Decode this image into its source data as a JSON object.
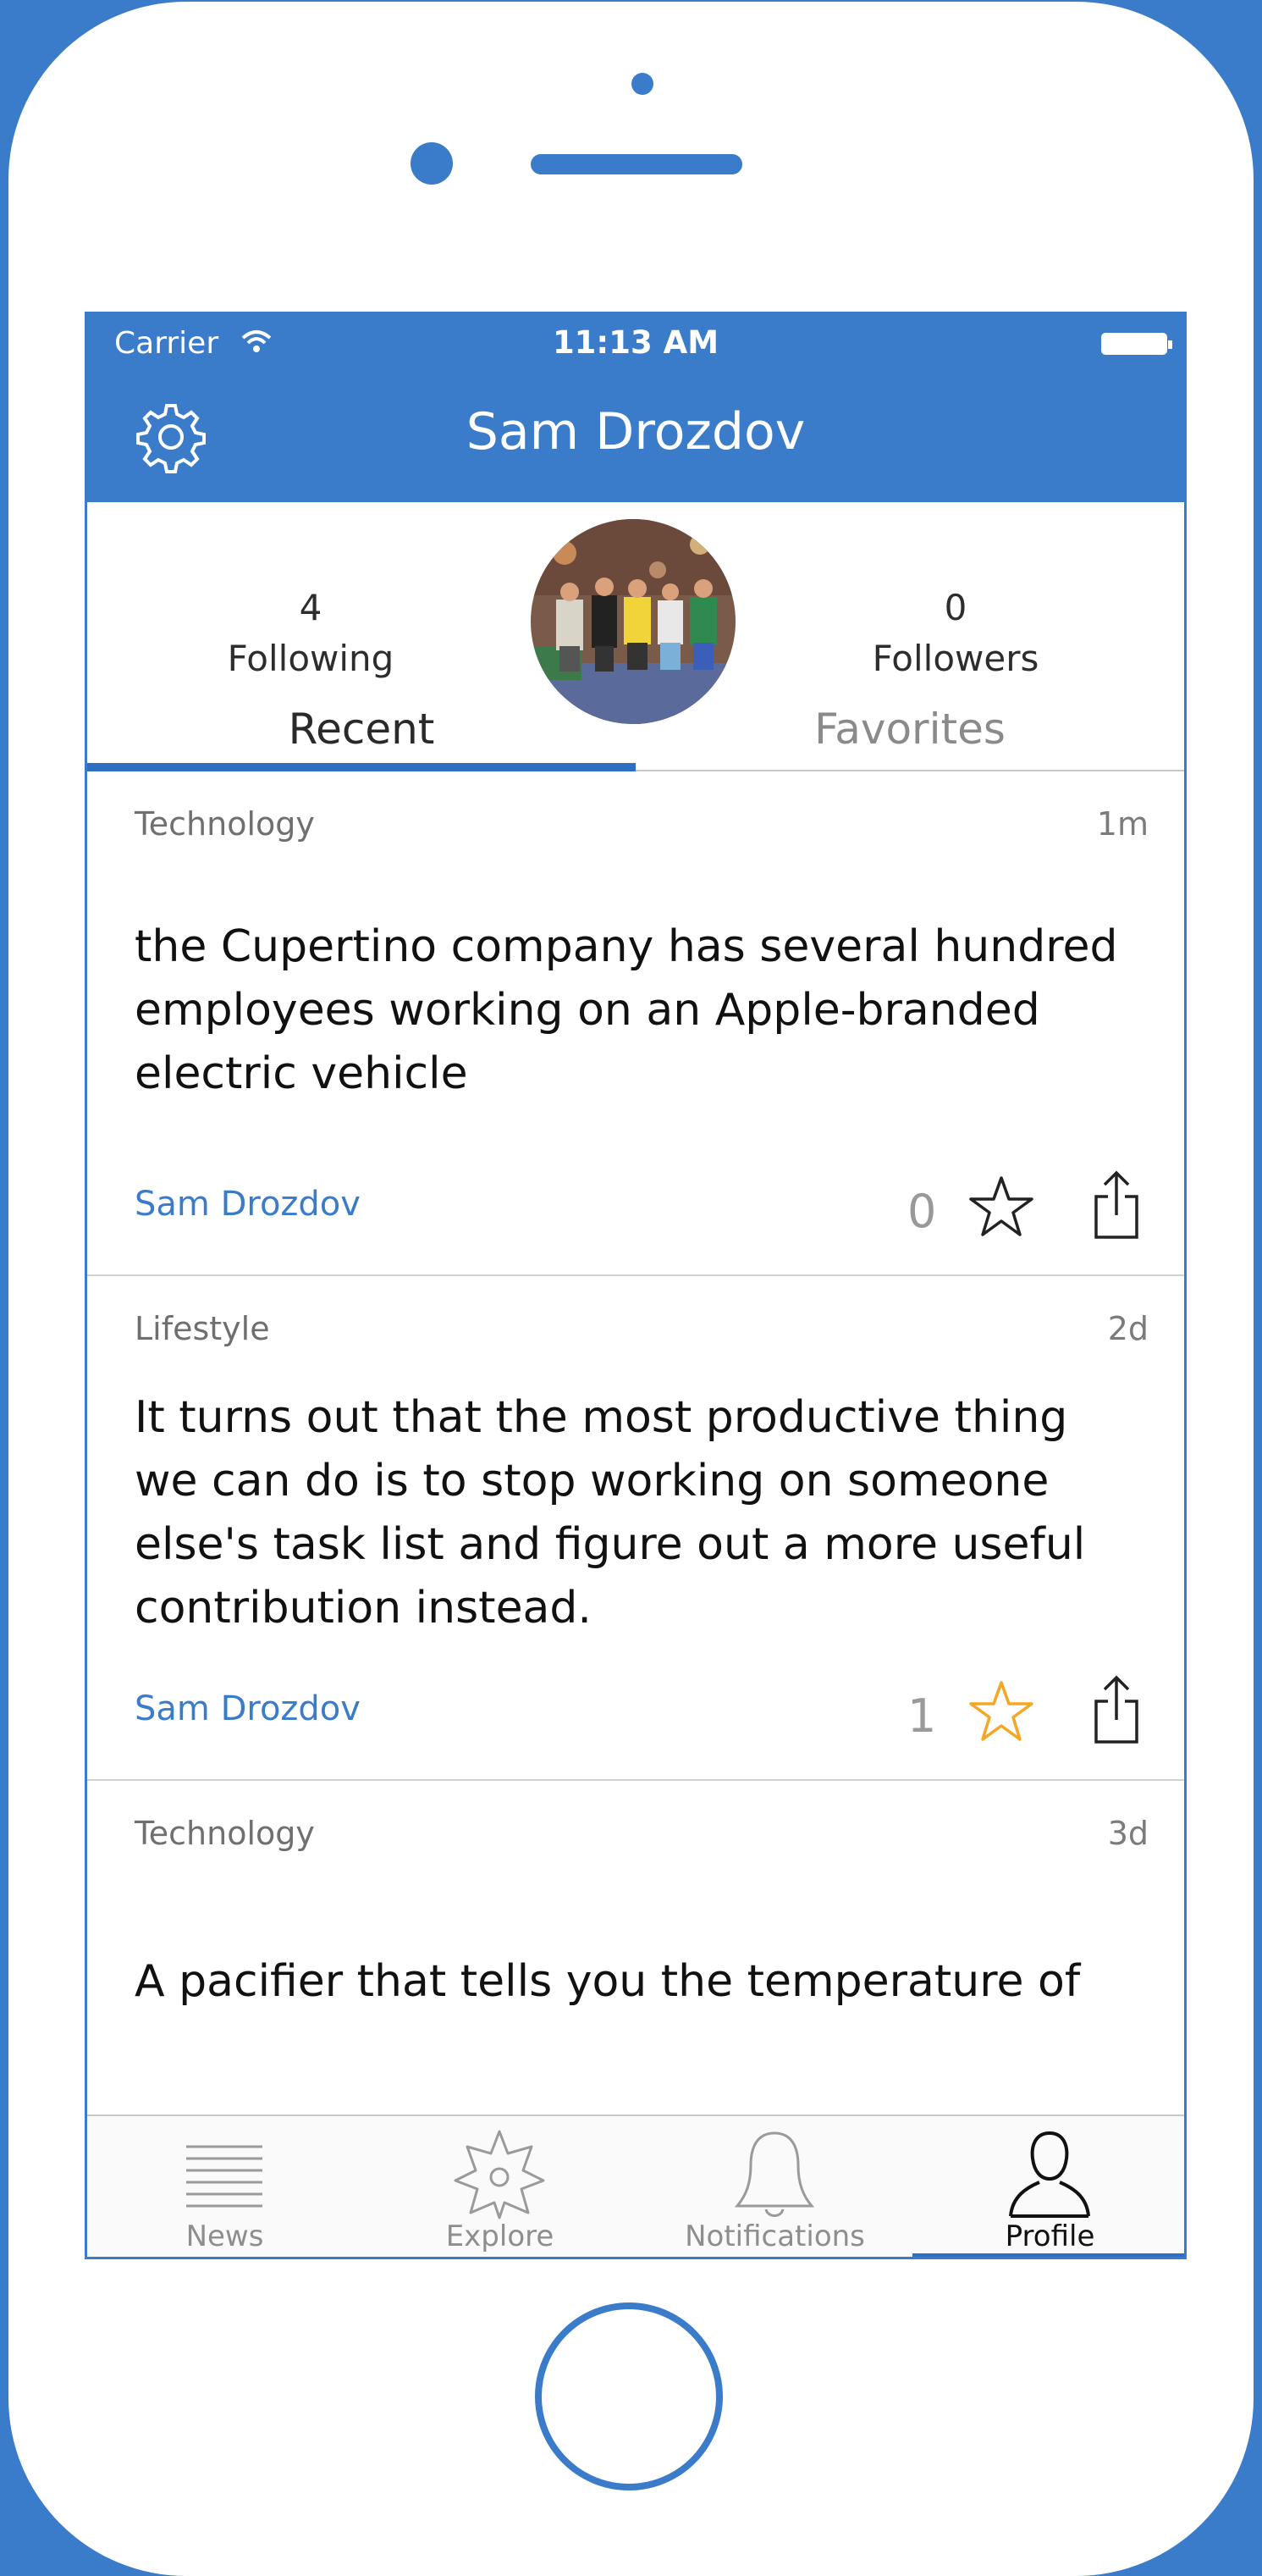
{
  "colors": {
    "brand": "#3a7cc9",
    "accent_underline": "#2e6fc4",
    "favorited_star": "#f5a623",
    "author_link": "#3a7cc9"
  },
  "status_bar": {
    "carrier": "Carrier",
    "time": "11:13 AM"
  },
  "navbar": {
    "title": "Sam Drozdov",
    "left_icon": "settings-icon"
  },
  "profile": {
    "following_count": "4",
    "following_label": "Following",
    "followers_count": "0",
    "followers_label": "Followers"
  },
  "tabs": {
    "recent": "Recent",
    "favorites": "Favorites",
    "selected": "Recent"
  },
  "posts": [
    {
      "category": "Technology",
      "age": "1m",
      "text": "the Cupertino company has several hundred employees working on an Apple-branded electric vehicle",
      "author": "Sam Drozdov",
      "likes": "0",
      "favorited": false
    },
    {
      "category": "Lifestyle",
      "age": "2d",
      "text": "It turns out that the most productive thing we can do is to stop working on someone else's task list and figure out a more useful contribution instead.",
      "author": "Sam Drozdov",
      "likes": "1",
      "favorited": true
    },
    {
      "category": "Technology",
      "age": "3d",
      "text": "A pacifier that tells you the temperature of",
      "author": "",
      "likes": "",
      "favorited": false
    }
  ],
  "tabbar": {
    "items": [
      {
        "label": "News",
        "icon": "news-icon"
      },
      {
        "label": "Explore",
        "icon": "explore-icon"
      },
      {
        "label": "Notifications",
        "icon": "bell-icon"
      },
      {
        "label": "Profile",
        "icon": "profile-icon"
      }
    ],
    "selected": "Profile"
  }
}
